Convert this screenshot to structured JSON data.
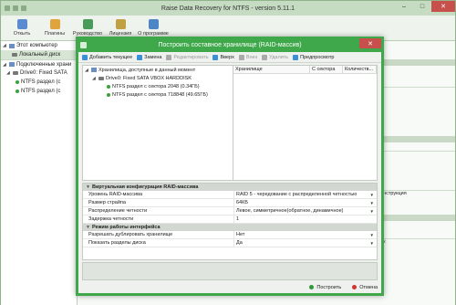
{
  "app": {
    "title": "Raise Data Recovery for NTFS - version 5.11.1",
    "min": "–",
    "max": "□",
    "close": "✕"
  },
  "ribbon": [
    {
      "label": "Откыть",
      "icon": "open-icon",
      "color": "#5a8bd1"
    },
    {
      "label": "Плагины",
      "icon": "plugins-icon",
      "color": "#e0a43c"
    },
    {
      "label": "Руководство",
      "icon": "manual-icon",
      "color": "#4a9a5a"
    },
    {
      "label": "Лицензия",
      "icon": "license-icon",
      "color": "#c0a040"
    },
    {
      "label": "О программе",
      "icon": "about-icon",
      "color": "#4c86c6"
    }
  ],
  "left": {
    "this_computer": "Этот компьютер",
    "local_disk": "Локальный диск",
    "connected": "Подключенные храни",
    "drive": "Drive0: Fixed SATA",
    "ntfs1": "NTFS раздел (с",
    "ntfs2": "NTFS раздел (с"
  },
  "right_fragments": {
    "a": "…",
    "b": "онструкция",
    "c": "ик"
  },
  "dialog": {
    "title": "Построить составное хранилище (RAID-массив)",
    "close": "✕",
    "toolbar": {
      "add": "Добавить текущее",
      "replace": "Замена",
      "edit": "Редактировать",
      "up": "Вверх",
      "down": "Вниз",
      "delete": "Удалить",
      "preview": "Предпросмотр"
    },
    "available": {
      "header": "Хранилища, доступные в данный момент",
      "drive": "Drive0: Fixed SATA VBOX HARDDISK",
      "part1": "NTFS раздел с сектора 2048 (0.34ГБ)",
      "part2": "NTFS раздел с сектора 718848 (49.65ГБ)"
    },
    "storage_cols": {
      "c1": "Хранилище",
      "c2": "С сектора",
      "c3": "Количеств..."
    },
    "props": {
      "group1": "Виртуальная конфигурация RAID-массива",
      "rows1": [
        {
          "name": "Уровень RAID-массива",
          "value": "RAID 5 - чередование с распределенной четностью",
          "dd": true
        },
        {
          "name": "Размер страйпа",
          "value": "64КБ",
          "dd": true
        },
        {
          "name": "Распределение четности",
          "value": "Левое, симметричное(обратное, динамичное)",
          "dd": true
        },
        {
          "name": "Задержка четности",
          "value": "1",
          "dd": false
        }
      ],
      "group2": "Режим работы интерфейса",
      "rows2": [
        {
          "name": "Разрешать дублировать хранилище",
          "value": "Нет",
          "dd": true
        },
        {
          "name": "Показать разделы диска",
          "value": "Да",
          "dd": true
        }
      ]
    },
    "footer": {
      "build": "Построить",
      "cancel": "Отмена",
      "build_color": "#2e9b39",
      "cancel_color": "#d2352e"
    }
  }
}
